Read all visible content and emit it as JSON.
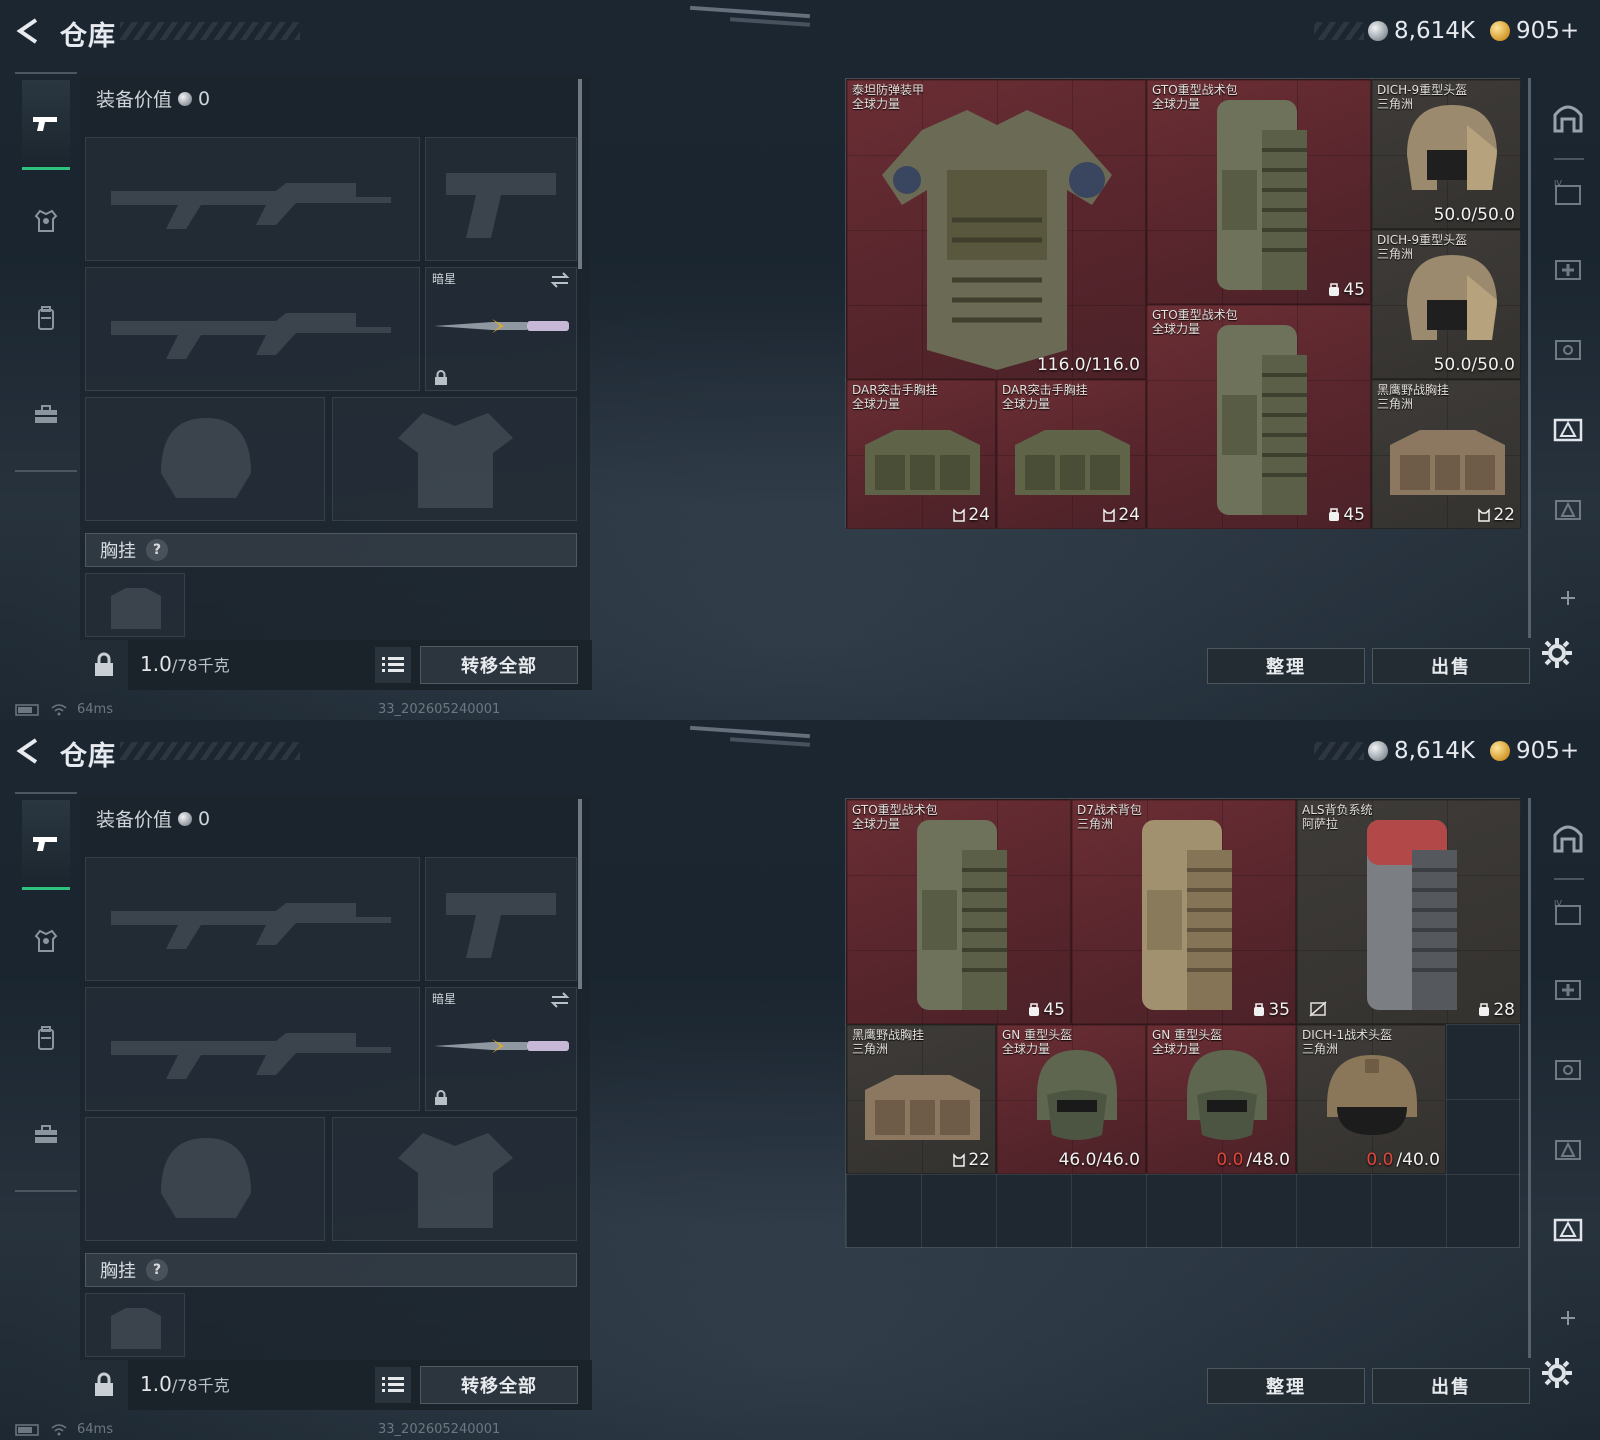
{
  "screens": [
    {
      "title": "仓库",
      "currency": {
        "silver": "8,614K",
        "gold": "905+"
      },
      "equipment": {
        "value_label": "装备价值",
        "value": "0",
        "melee_name": "暗星",
        "chest_rig_label": "胸挂",
        "chest_rig_help": "?"
      },
      "weight": {
        "current": "1.0",
        "max": "/78千克"
      },
      "transfer_all": "转移全部",
      "status": {
        "ping": "64ms",
        "build": "33_202605240001"
      },
      "stash_items": [
        {
          "name": "泰坦防弹装甲",
          "origin": "全球力量",
          "value": "116.0/116.0",
          "color": "red"
        },
        {
          "name": "GTO重型战术包",
          "origin": "全球力量",
          "value": "45",
          "color": "red"
        },
        {
          "name": "DICH-9重型头盔",
          "origin": "三角洲",
          "value": "50.0/50.0",
          "color": "dark"
        },
        {
          "name": "DICH-9重型头盔",
          "origin": "三角洲",
          "value": "50.0/50.0",
          "color": "dark"
        },
        {
          "name": "GTO重型战术包",
          "origin": "全球力量",
          "value": "45",
          "color": "red"
        },
        {
          "name": "DAR突击手胸挂",
          "origin": "全球力量",
          "value": "24",
          "color": "red"
        },
        {
          "name": "DAR突击手胸挂",
          "origin": "全球力量",
          "value": "24",
          "color": "red"
        },
        {
          "name": "黑鹰野战胸挂",
          "origin": "三角洲",
          "value": "22",
          "color": "dark"
        }
      ],
      "buttons": {
        "sort": "整理",
        "sell": "出售"
      }
    },
    {
      "title": "仓库",
      "currency": {
        "silver": "8,614K",
        "gold": "905+"
      },
      "equipment": {
        "value_label": "装备价值",
        "value": "0",
        "melee_name": "暗星",
        "chest_rig_label": "胸挂",
        "chest_rig_help": "?"
      },
      "weight": {
        "current": "1.0",
        "max": "/78千克"
      },
      "transfer_all": "转移全部",
      "status": {
        "ping": "64ms",
        "build": "33_202605240001"
      },
      "stash_items": [
        {
          "name": "GTO重型战术包",
          "origin": "全球力量",
          "value": "45",
          "color": "red"
        },
        {
          "name": "D7战术背包",
          "origin": "三角洲",
          "value": "35",
          "color": "red"
        },
        {
          "name": "ALS背负系统",
          "origin": "阿萨拉",
          "value": "28",
          "color": "dark"
        },
        {
          "name": "黑鹰野战胸挂",
          "origin": "三角洲",
          "value": "22",
          "color": "dark"
        },
        {
          "name": "GN 重型头盔",
          "origin": "全球力量",
          "value": "46.0/46.0",
          "color": "red"
        },
        {
          "name": "GN 重型头盔",
          "origin": "全球力量",
          "value_cur": "0.0",
          "value_max": "/48.0",
          "color": "red"
        },
        {
          "name": "DICH-1战术头盔",
          "origin": "三角洲",
          "value_cur": "0.0",
          "value_max": "/40.0",
          "color": "dark"
        }
      ],
      "buttons": {
        "sort": "整理",
        "sell": "出售"
      }
    }
  ],
  "colors": {
    "accent_green": "#2ec27e",
    "red_rarity": "#5f282f",
    "durability_zero": "#e0463c"
  }
}
